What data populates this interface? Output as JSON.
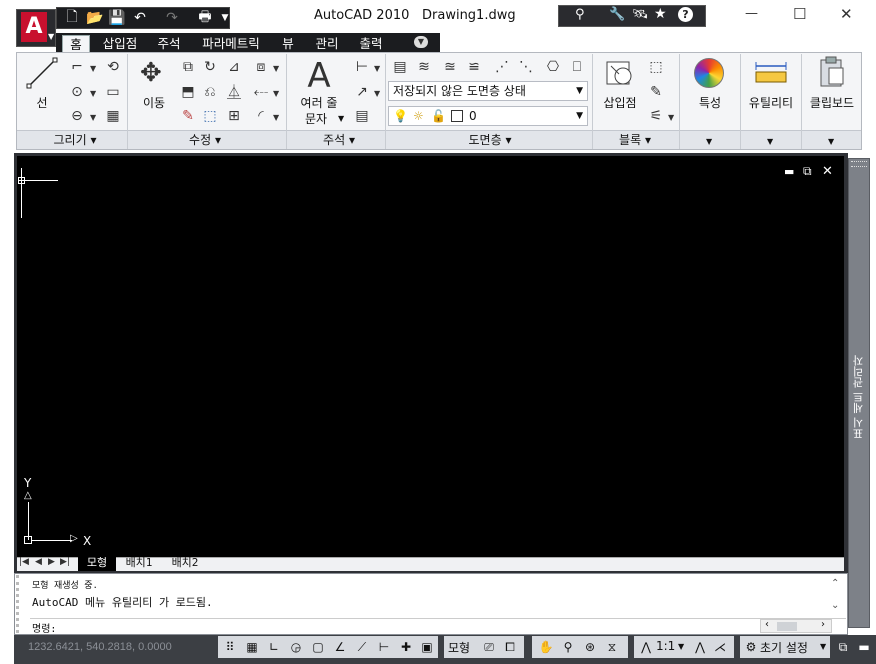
{
  "window": {
    "app_name": "AutoCAD 2010",
    "file_name": "Drawing1.dwg",
    "minimize": "—",
    "maximize": "☐",
    "close": "✕"
  },
  "app_button": {
    "letter": "A"
  },
  "ribbon_tabs": [
    "홈",
    "삽입점",
    "주석",
    "파라메트릭",
    "뷰",
    "관리",
    "출력"
  ],
  "ribbon_panels": {
    "draw": {
      "title": "그리기",
      "line_label": "선"
    },
    "modify": {
      "title": "수정",
      "move_label": "이동"
    },
    "annotation": {
      "title": "주석",
      "text_label_1": "여러 줄",
      "text_label_2": "문자",
      "text_glyph": "A"
    },
    "layers": {
      "title": "도면층",
      "layer_state": "저장되지 않은 도면층 상태",
      "current_layer": "0"
    },
    "block": {
      "title": "블록",
      "insert_label": "삽입점"
    },
    "properties": {
      "label": "특성"
    },
    "utilities": {
      "label": "유틸리티"
    },
    "clipboard": {
      "label": "클립보드"
    }
  },
  "viewport": {
    "axis_x": "X",
    "axis_y": "Y"
  },
  "layout_tabs": [
    "모형",
    "배치1",
    "배치2"
  ],
  "command_history": [
    "모형 재생성 중.",
    "AutoCAD 메뉴 유틸리티 가 로드됨."
  ],
  "command_prompt": "명령:",
  "side_palette": {
    "title": "표시 세트 관리자"
  },
  "status_bar": {
    "coordinates": "1232.6421, 540.2818, 0.0000",
    "model_label": "모형",
    "scale": "1:1",
    "workspace": "초기 설정"
  },
  "colors": {
    "title_bar": "#0f0f10",
    "ribbon_bg": "#f4f5f7",
    "canvas_bg": "#000000",
    "accent_red": "#c8102e",
    "status_bg": "#3c3f44"
  }
}
